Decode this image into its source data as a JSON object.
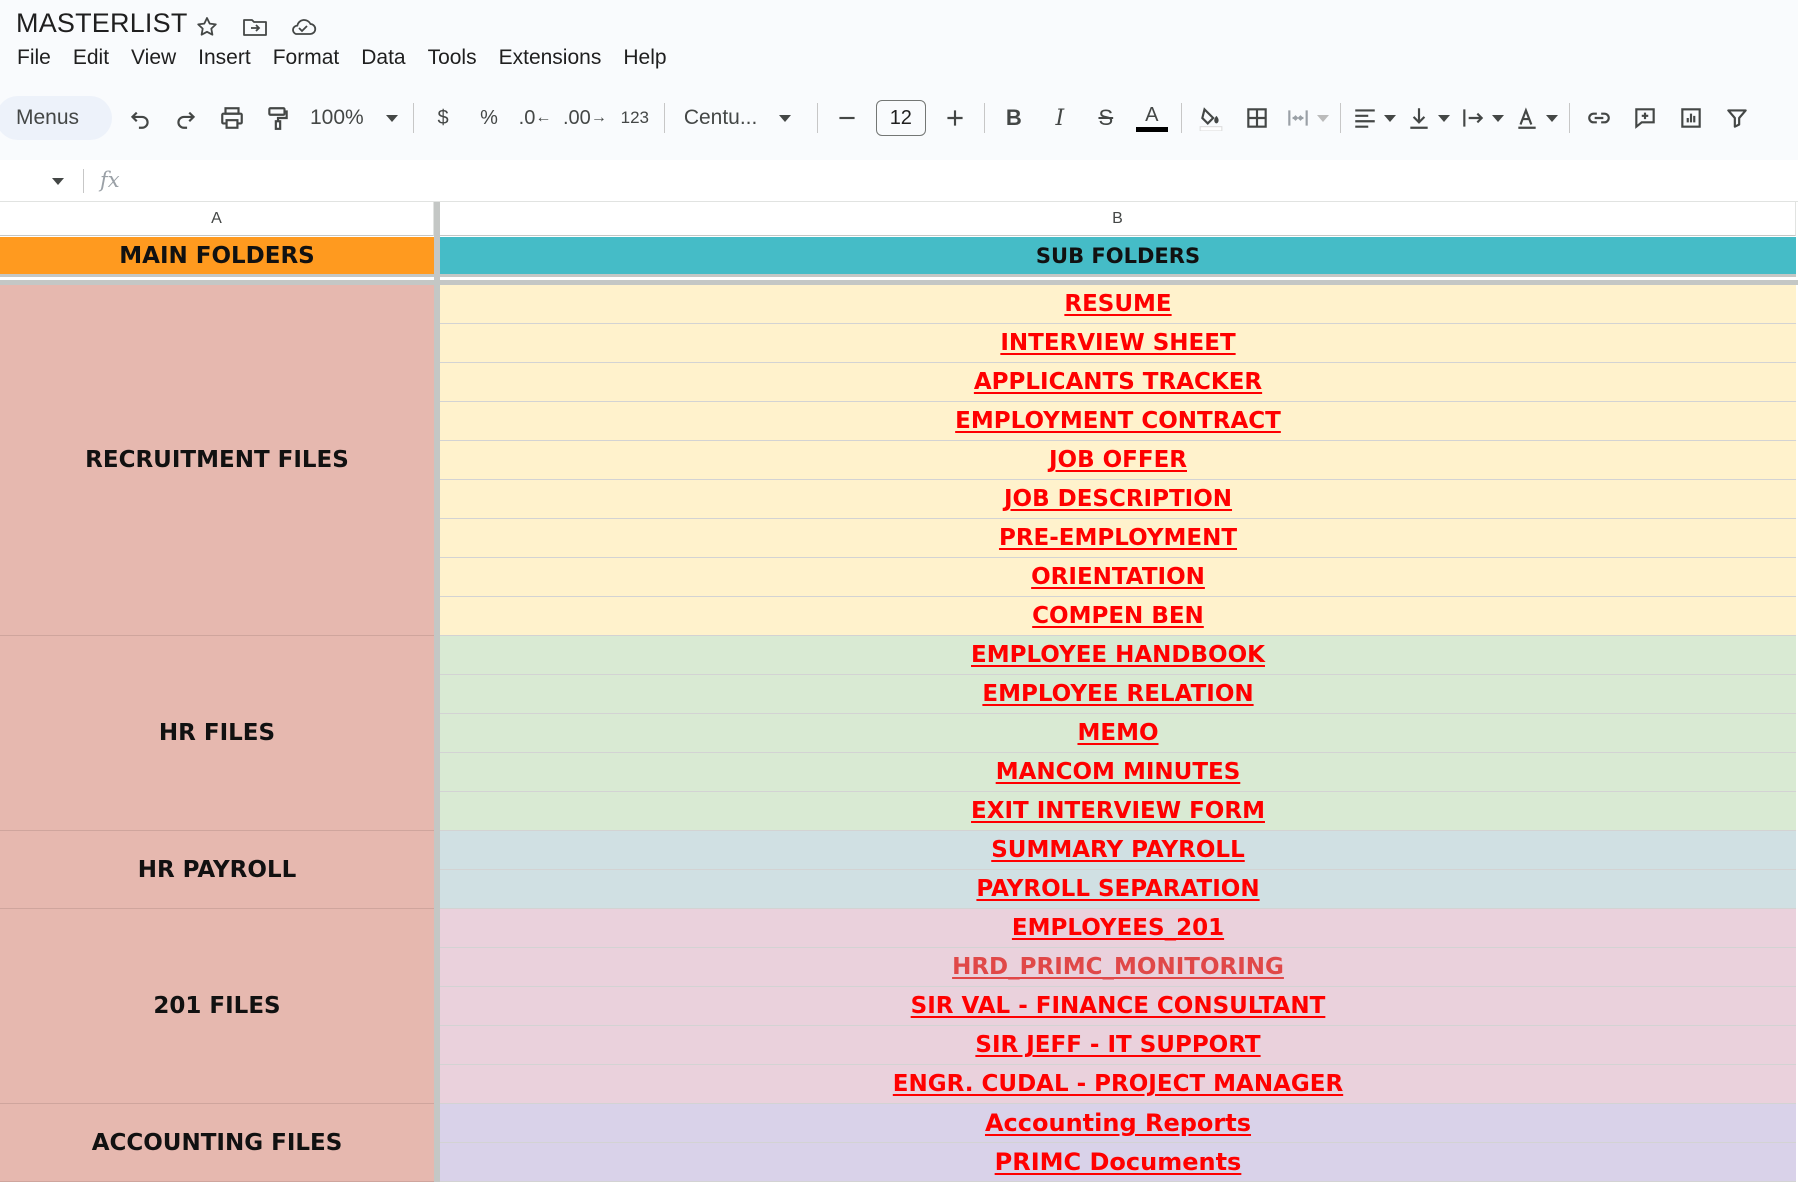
{
  "app": {
    "doc_title": "MASTERLIST",
    "title_icons": [
      "star-icon",
      "move-to-folder-icon",
      "cloud-saved-icon"
    ]
  },
  "menubar": [
    "File",
    "Edit",
    "View",
    "Insert",
    "Format",
    "Data",
    "Tools",
    "Extensions",
    "Help"
  ],
  "toolbar": {
    "menus_label": "Menus",
    "zoom": "100%",
    "currency": "$",
    "percent": "%",
    "decrease_decimal": ".0",
    "increase_decimal": ".00",
    "number_format": "123",
    "font": "Centu...",
    "font_size": "12"
  },
  "formula_bar": {
    "fx_label": "fx"
  },
  "columns": {
    "a": "A",
    "b": "B"
  },
  "sheet": {
    "header_main": "MAIN FOLDERS",
    "header_sub": "SUB FOLDERS",
    "groups": [
      {
        "name": "RECRUITMENT FILES",
        "color": "#fff2cc",
        "items": [
          "RESUME",
          "INTERVIEW SHEET",
          "APPLICANTS TRACKER",
          "EMPLOYMENT CONTRACT",
          "JOB OFFER",
          "JOB DESCRIPTION",
          "PRE-EMPLOYMENT",
          "ORIENTATION",
          "COMPEN BEN"
        ]
      },
      {
        "name": "HR FILES",
        "color": "#d9ead3",
        "items": [
          "EMPLOYEE HANDBOOK",
          "EMPLOYEE RELATION",
          "MEMO",
          "MANCOM MINUTES",
          "EXIT INTERVIEW FORM"
        ]
      },
      {
        "name": "HR PAYROLL",
        "color": "#d0e0e3",
        "items": [
          "SUMMARY PAYROLL",
          "PAYROLL SEPARATION"
        ]
      },
      {
        "name": "201 FILES",
        "color": "#ead1dc",
        "items": [
          "EMPLOYEES_201",
          "HRD_PRIMC_MONITORING",
          "SIR VAL - FINANCE CONSULTANT",
          "SIR JEFF - IT SUPPORT",
          "ENGR. CUDAL - PROJECT MANAGER"
        ]
      },
      {
        "name": "ACCOUNTING FILES",
        "color": "#d9d2e9",
        "items": [
          "Accounting Reports",
          "PRIMC Documents"
        ]
      }
    ]
  }
}
